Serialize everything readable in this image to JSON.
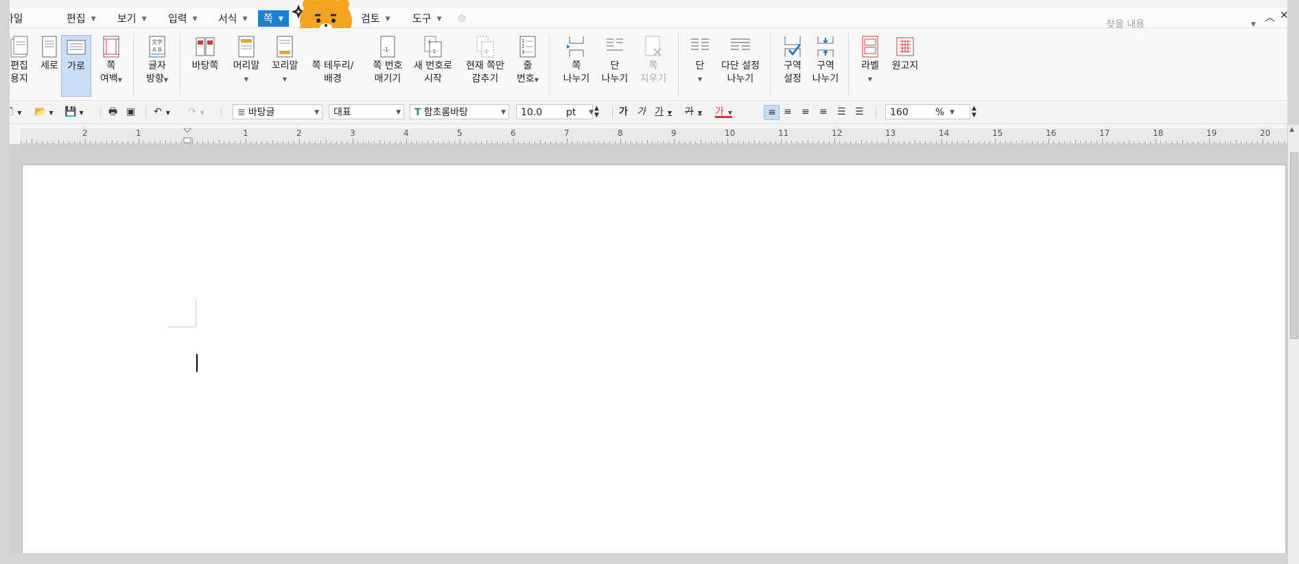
{
  "menu": {
    "file": "파일",
    "items": [
      "편집",
      "보기",
      "입력",
      "서식",
      "쪽",
      "검토",
      "도구"
    ],
    "active_index": 4,
    "search_placeholder": "찾을 내용"
  },
  "ribbon": {
    "buttons": [
      {
        "l1": "편집",
        "l2": "용지"
      },
      {
        "l1": "세로",
        "l2": ""
      },
      {
        "l1": "가로",
        "l2": ""
      },
      {
        "l1": "쪽",
        "l2": "여백"
      },
      {
        "l1": "글자",
        "l2": "방향"
      },
      {
        "l1": "바탕쪽",
        "l2": ""
      },
      {
        "l1": "머리말",
        "l2": ""
      },
      {
        "l1": "꼬리말",
        "l2": ""
      },
      {
        "l1": "쪽 테두리/",
        "l2": "배경"
      },
      {
        "l1": "쪽 번호",
        "l2": "매기기"
      },
      {
        "l1": "새 번호로",
        "l2": "시작"
      },
      {
        "l1": "현재 쪽만",
        "l2": "감추기"
      },
      {
        "l1": "줄",
        "l2": "번호"
      },
      {
        "l1": "쪽",
        "l2": "나누기"
      },
      {
        "l1": "단",
        "l2": "나누기"
      },
      {
        "l1": "쪽",
        "l2": "지우기"
      },
      {
        "l1": "단",
        "l2": ""
      },
      {
        "l1": "다단 설정",
        "l2": "나누기"
      },
      {
        "l1": "구역",
        "l2": "설정"
      },
      {
        "l1": "구역",
        "l2": "나누기"
      },
      {
        "l1": "라벨",
        "l2": ""
      },
      {
        "l1": "원고지",
        "l2": ""
      }
    ]
  },
  "format": {
    "style": "바탕글",
    "lang": "대표",
    "font": "함초롬바탕",
    "size": "10.0",
    "unit": "pt",
    "zoom": "160",
    "zoom_unit": "%",
    "bold": "가",
    "italic": "가",
    "underline": "가",
    "strike": "가",
    "color": "가"
  },
  "ruler": {
    "numbers": [
      "2",
      "1",
      "1",
      "2",
      "3",
      "4",
      "5",
      "6",
      "7",
      "8",
      "9",
      "10",
      "11",
      "12",
      "13",
      "14",
      "15",
      "16",
      "17",
      "18",
      "19",
      "20"
    ]
  },
  "colors": {
    "accent": "#1a7fd6",
    "selected": "#c9def5",
    "mascot": "#f2a51f"
  }
}
